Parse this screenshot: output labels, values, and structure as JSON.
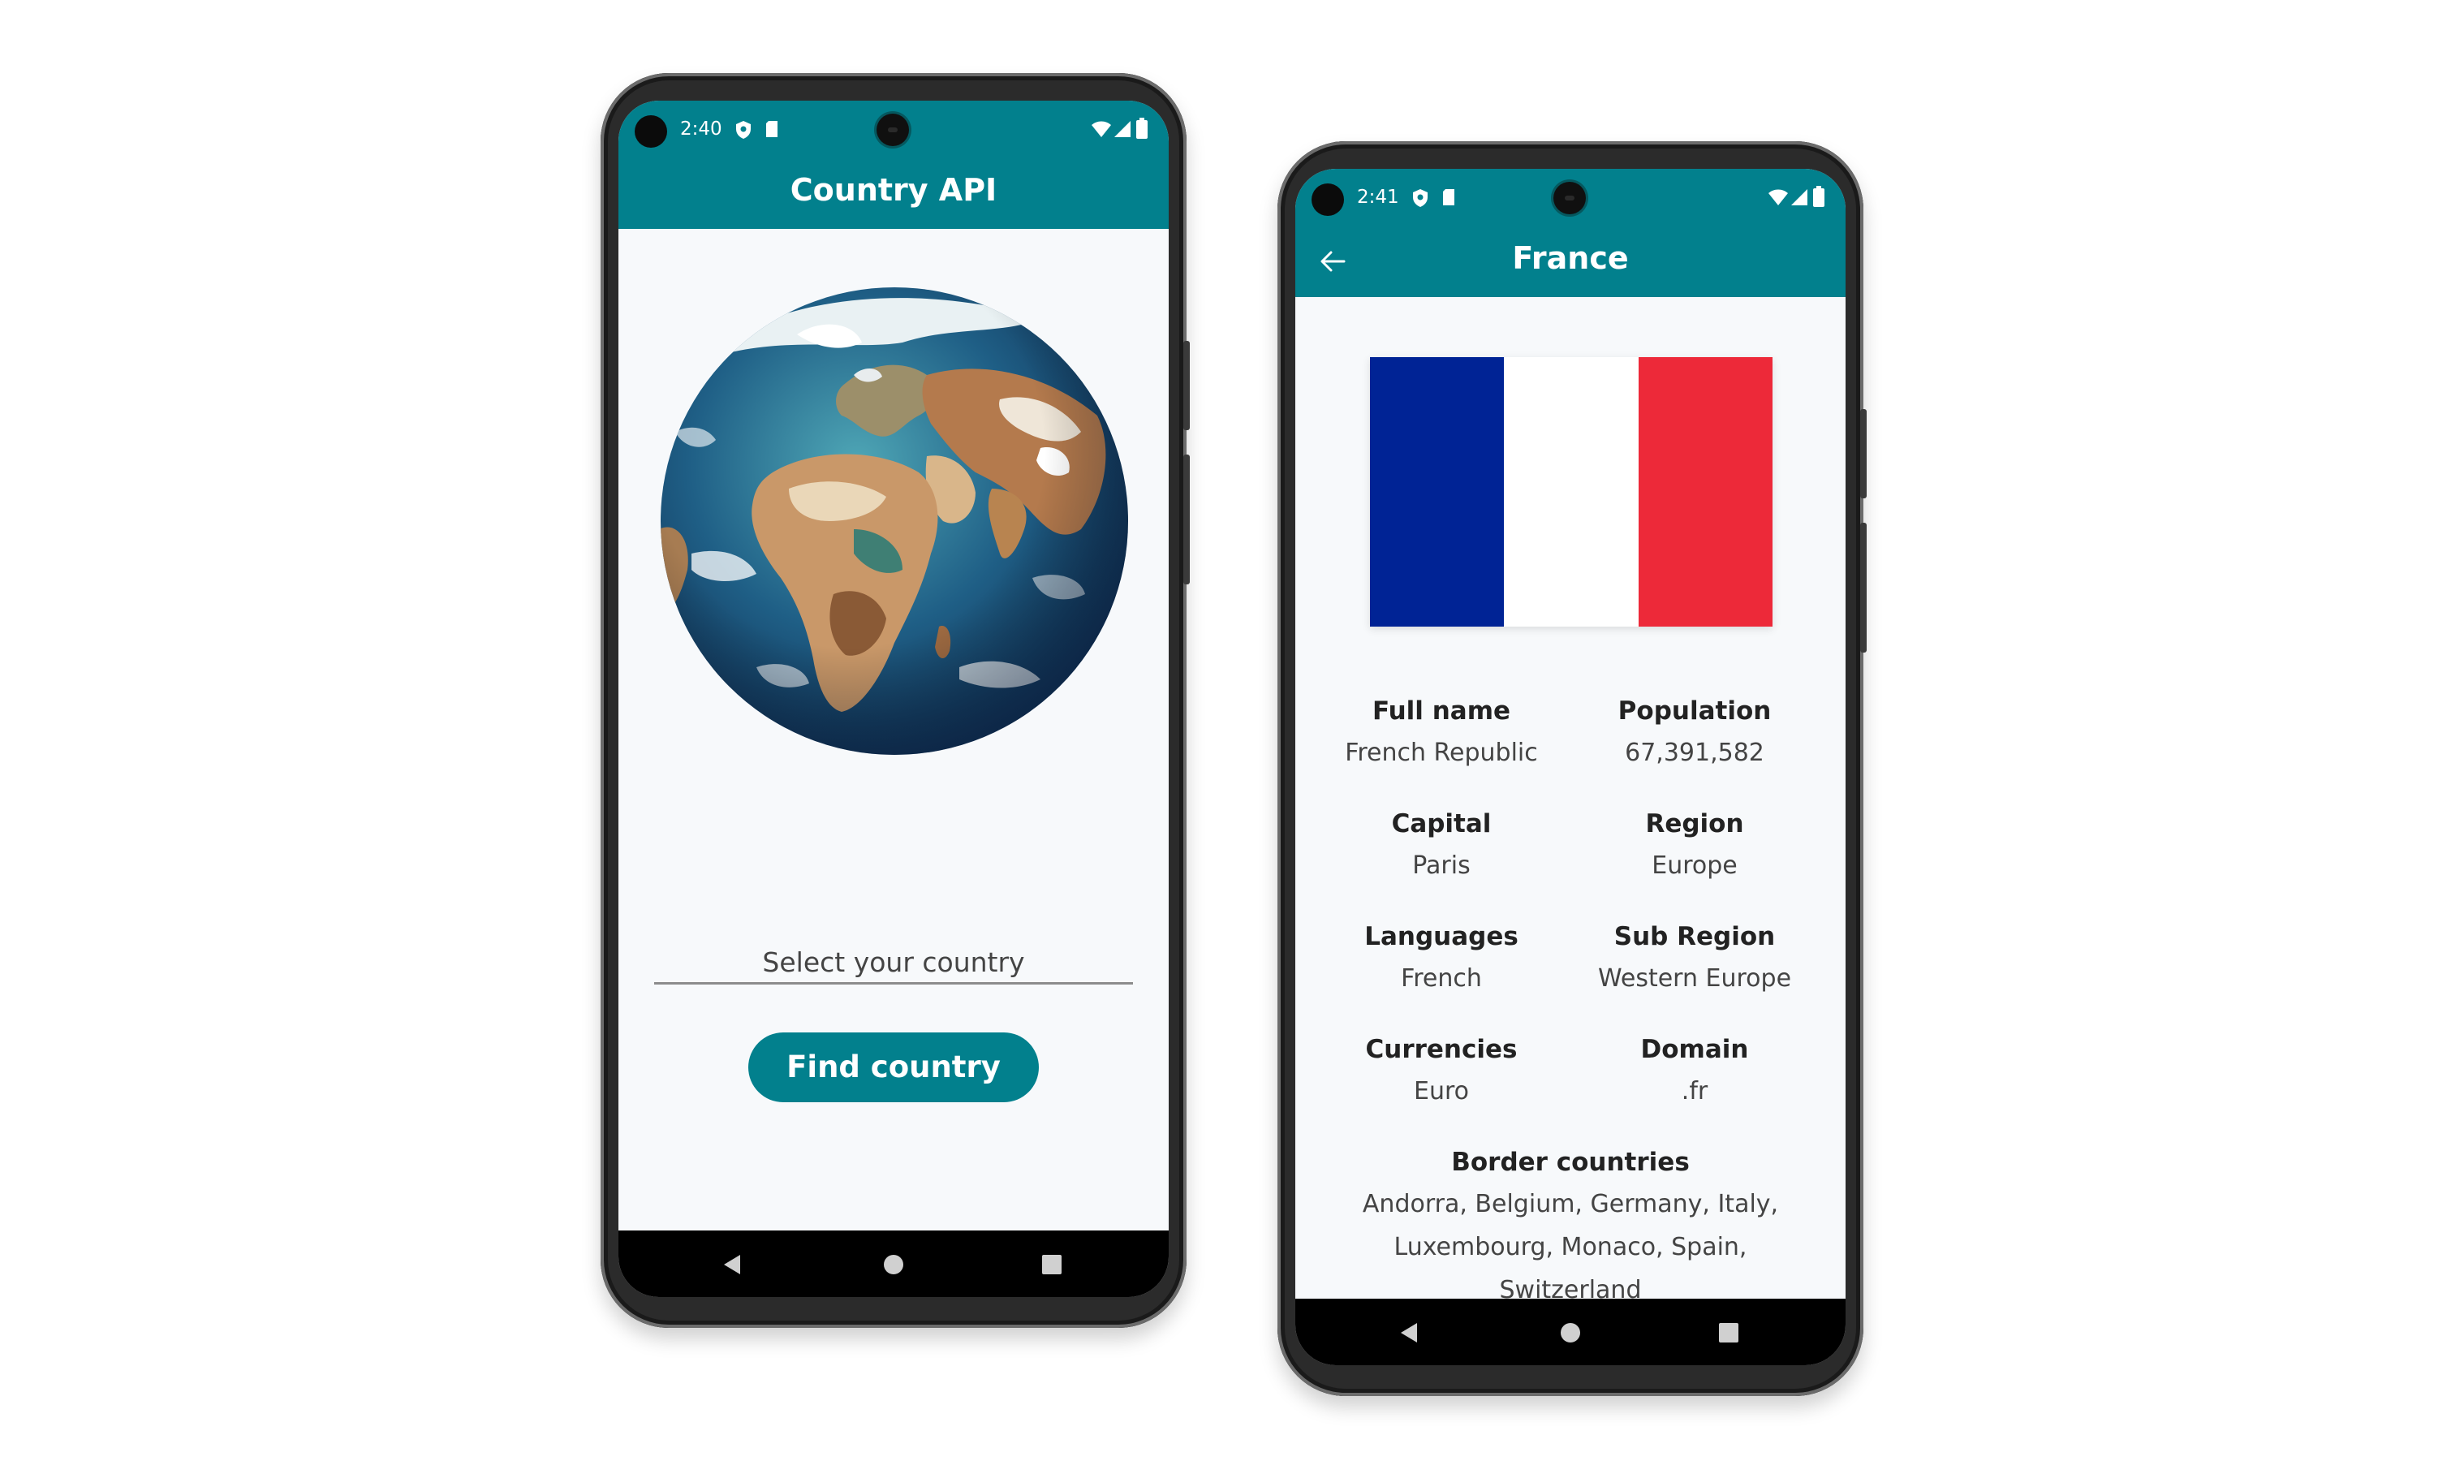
{
  "left_phone": {
    "status_time": "2:40",
    "app_title": "Country API",
    "select_placeholder": "Select your country",
    "find_button": "Find country"
  },
  "right_phone": {
    "status_time": "2:41",
    "app_title": "France",
    "flag_colors": [
      "#002395",
      "#ffffff",
      "#ed2939"
    ],
    "details": {
      "full_name_label": "Full name",
      "full_name_value": "French Republic",
      "population_label": "Population",
      "population_value": "67,391,582",
      "capital_label": "Capital",
      "capital_value": "Paris",
      "region_label": "Region",
      "region_value": "Europe",
      "languages_label": "Languages",
      "languages_value": "French",
      "subregion_label": "Sub Region",
      "subregion_value": "Western Europe",
      "currencies_label": "Currencies",
      "currencies_value": "Euro",
      "domain_label": "Domain",
      "domain_value": ".fr",
      "border_label": "Border countries",
      "border_line1": "Andorra, Belgium, Germany, Italy,",
      "border_line2": "Luxembourg, Monaco, Spain,",
      "border_line3": "Switzerland"
    }
  },
  "colors": {
    "accent": "#02808d",
    "screen_bg": "#f7f9fb"
  }
}
